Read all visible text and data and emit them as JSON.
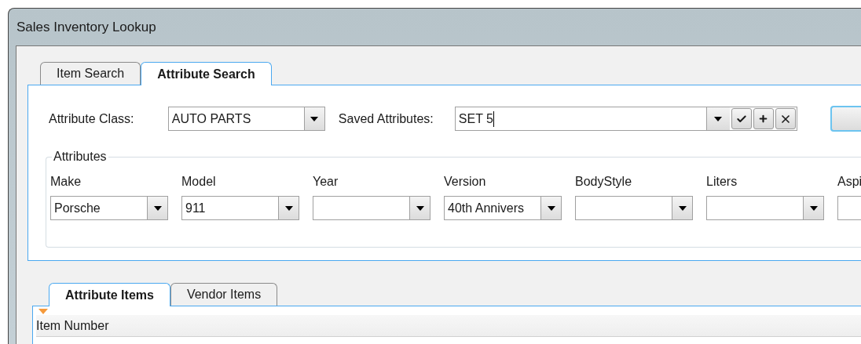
{
  "window": {
    "title": "Sales Inventory Lookup"
  },
  "tabs": [
    {
      "label": "Item Search",
      "selected": false
    },
    {
      "label": "Attribute Search",
      "selected": true
    }
  ],
  "attribute_class": {
    "label": "Attribute Class:",
    "value": "AUTO PARTS"
  },
  "saved_attributes": {
    "label": "Saved Attributes:",
    "value": "SET 5"
  },
  "attributes": {
    "title": "Attributes",
    "fields": [
      {
        "label": "Make",
        "value": "Porsche"
      },
      {
        "label": "Model",
        "value": "911"
      },
      {
        "label": "Year"
      },
      {
        "label": "Version",
        "value": "40th Annivers"
      },
      {
        "label": "BodyStyle"
      },
      {
        "label": "Liters"
      },
      {
        "label": "Aspi"
      }
    ]
  },
  "item_tabs": [
    {
      "label": "Attribute Items",
      "selected": true
    },
    {
      "label": "Vendor Items",
      "selected": false
    }
  ],
  "grid": {
    "columns": [
      "Item Number"
    ]
  }
}
